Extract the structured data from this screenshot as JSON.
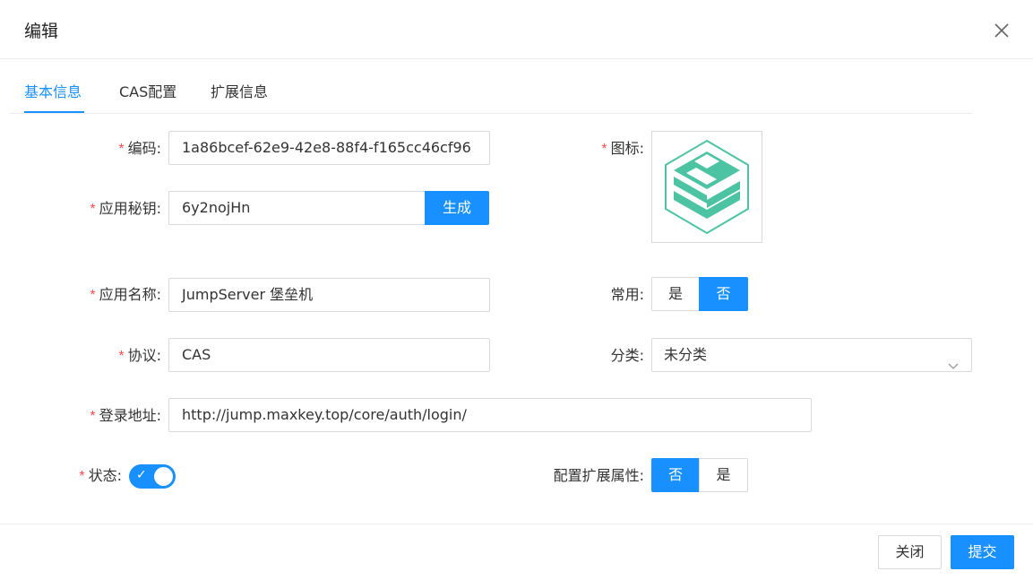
{
  "dialog": {
    "title": "编辑"
  },
  "tabs": [
    {
      "label": "基本信息",
      "active": true
    },
    {
      "label": "CAS配置",
      "active": false
    },
    {
      "label": "扩展信息",
      "active": false
    }
  ],
  "form": {
    "required_mark": "*",
    "code": {
      "label": "编码:",
      "value": "1a86bcef-62e9-42e8-88f4-f165cc46cf96"
    },
    "secret": {
      "label": "应用秘钥:",
      "value": "6y2nojHn",
      "generate_label": "生成"
    },
    "app_name": {
      "label": "应用名称:",
      "value": "JumpServer 堡垒机"
    },
    "protocol": {
      "label": "协议:",
      "value": "CAS"
    },
    "login_url": {
      "label": "登录地址:",
      "value": "http://jump.maxkey.top/core/auth/login/"
    },
    "status": {
      "label": "状态:",
      "enabled": true,
      "check": "✓"
    },
    "icon": {
      "label": "图标:",
      "icon_name": "jumpserver-logo-icon"
    },
    "frequent": {
      "label": "常用:",
      "yes": "是",
      "no": "否",
      "selected": "否"
    },
    "category": {
      "label": "分类:",
      "value": "未分类"
    },
    "ext_attr": {
      "label": "配置扩展属性:",
      "no": "否",
      "yes": "是",
      "selected": "否"
    }
  },
  "footer": {
    "close_label": "关闭",
    "submit_label": "提交"
  },
  "colors": {
    "primary": "#1890ff",
    "required": "#ff4d4f",
    "logo": "#4cc4a4"
  }
}
